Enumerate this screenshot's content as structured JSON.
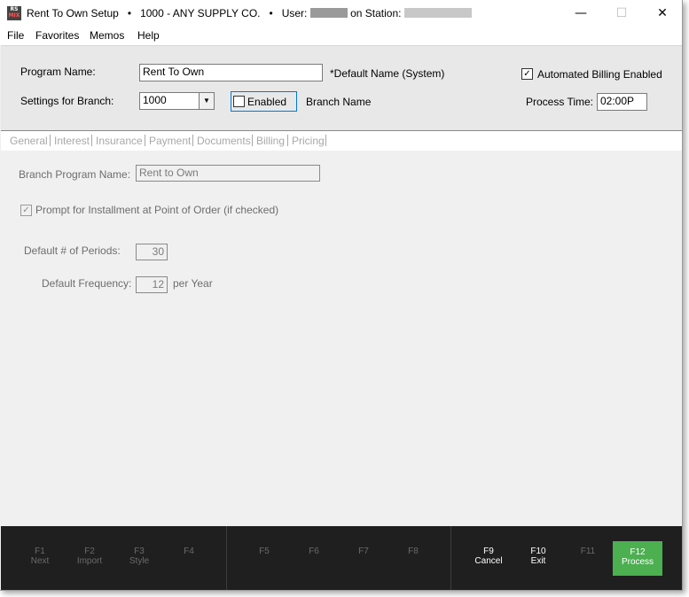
{
  "titlebar": {
    "app_icon_text": "RS MIX",
    "title": "Rent To Own Setup",
    "sep1": "•",
    "branch_company": "1000 - ANY SUPPLY CO.",
    "sep2": "•",
    "user_label": "User:",
    "station_label": "on Station:",
    "min_glyph": "—",
    "max_glyph": "☐",
    "close_glyph": "✕"
  },
  "menu": [
    "File",
    "Favorites",
    "Memos",
    "Help"
  ],
  "header": {
    "program_name_label": "Program Name:",
    "program_name_value": "Rent To Own",
    "default_name_note": "*Default Name (System)",
    "automated_billing_label": "Automated Billing Enabled",
    "automated_billing_checked": true,
    "settings_branch_label": "Settings for Branch:",
    "branch_value": "1000",
    "enabled_label": "Enabled",
    "enabled_checked": false,
    "branch_name_label": "Branch Name",
    "process_time_label": "Process Time:",
    "process_time_value": "02:00P"
  },
  "tabs": [
    "General",
    "Interest",
    "Insurance",
    "Payment",
    "Documents",
    "Billing",
    "Pricing"
  ],
  "general": {
    "branch_program_name_label": "Branch Program Name:",
    "branch_program_name_value": "Rent to Own",
    "prompt_installment_label": "Prompt for Installment at Point of Order (if checked)",
    "prompt_installment_checked": true,
    "default_periods_label": "Default # of Periods:",
    "default_periods_value": "30",
    "default_frequency_label": "Default Frequency:",
    "default_frequency_value": "12",
    "per_year_label": "per Year"
  },
  "fkeys": [
    {
      "key": "F1",
      "label": "Next"
    },
    {
      "key": "F2",
      "label": "Import"
    },
    {
      "key": "F3",
      "label": "Style"
    },
    {
      "key": "F4",
      "label": ""
    },
    {
      "key": "F5",
      "label": ""
    },
    {
      "key": "F6",
      "label": ""
    },
    {
      "key": "F7",
      "label": ""
    },
    {
      "key": "F8",
      "label": ""
    },
    {
      "key": "F9",
      "label": "Cancel"
    },
    {
      "key": "F10",
      "label": "Exit"
    },
    {
      "key": "F11",
      "label": ""
    },
    {
      "key": "F12",
      "label": "Process"
    }
  ],
  "colors": {
    "process_button": "#4caf50",
    "fkey_bar": "#1f1f1f",
    "focus_border": "#0078d7"
  }
}
